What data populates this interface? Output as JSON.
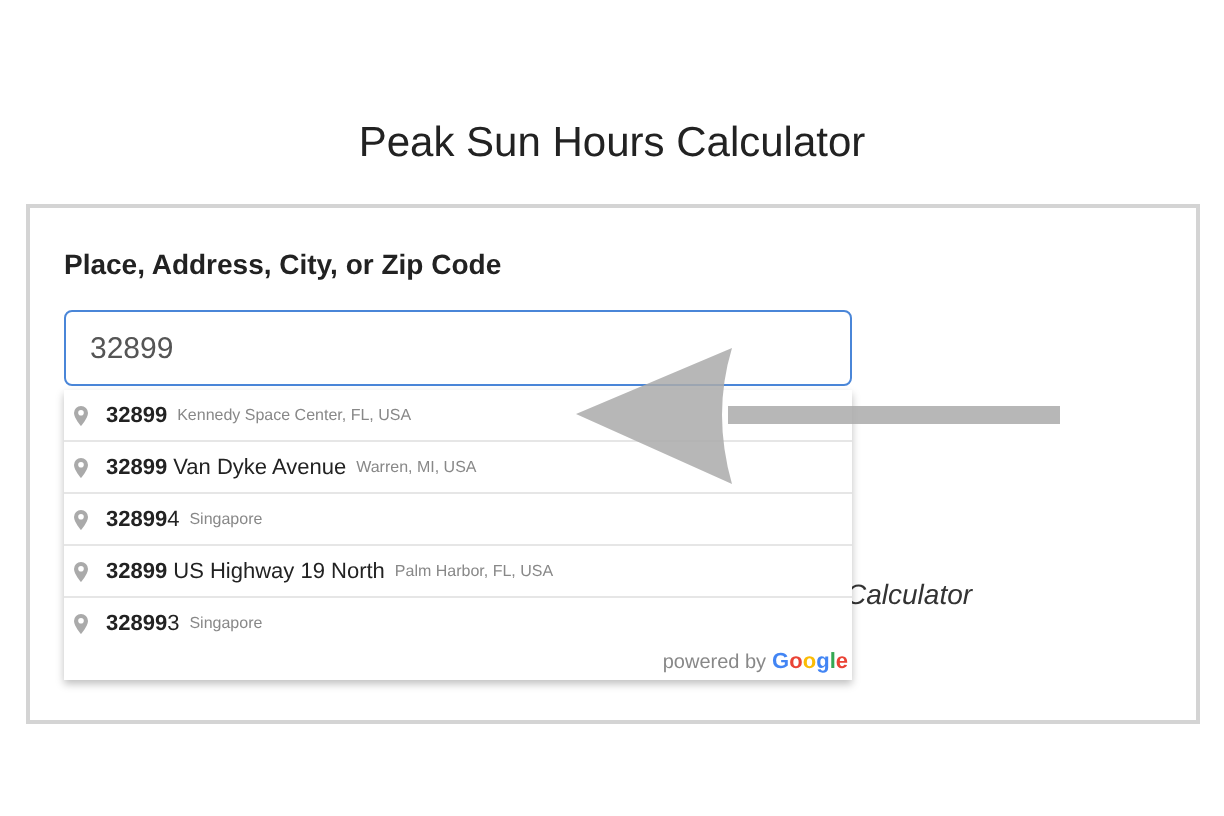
{
  "title": "Peak Sun Hours Calculator",
  "form": {
    "label": "Place, Address, City, or Zip Code",
    "input": {
      "value": "32899",
      "focused": true
    },
    "suggestions": [
      {
        "main": "**32899**",
        "secondary": "Kennedy Space Center, FL, USA"
      },
      {
        "main": "**32899** Van Dyke Avenue",
        "secondary": "Warren, MI, USA"
      },
      {
        "main": "**32899**4",
        "secondary": "Singapore"
      },
      {
        "main": "**32899** US Highway 19 North",
        "secondary": "Palm Harbor, FL, USA"
      },
      {
        "main": "**32899**3",
        "secondary": "Singapore"
      }
    ],
    "attribution": {
      "prefix": "powered by",
      "brand": "Google"
    },
    "behind_text": "Calculator"
  }
}
